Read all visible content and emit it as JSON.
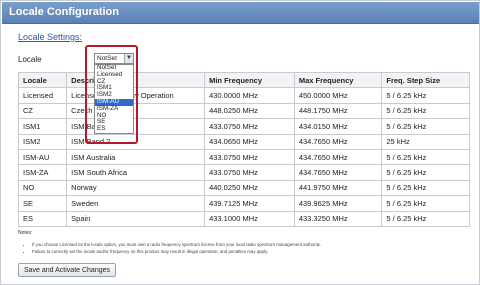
{
  "window": {
    "title": "Locale Configuration"
  },
  "section_link": "Locale Settings:",
  "locale": {
    "label": "Locale",
    "selected": "NotSet",
    "options": [
      "NotSet",
      "Licensed",
      "CZ",
      "ISM1",
      "ISM2",
      "ISM-AU",
      "ISM-ZA",
      "NO",
      "SE",
      "ES"
    ],
    "highlighted_option": "ISM-AU"
  },
  "table": {
    "headers": [
      "Locale",
      "Description",
      "Min Frequency",
      "Max Frequency",
      "Freq. Step Size"
    ],
    "rows": [
      [
        "Licensed",
        "Licensed Frequency Operation",
        "430.0000 MHz",
        "450.0000 MHz",
        "5 / 6.25 kHz"
      ],
      [
        "CZ",
        "Czech Republic",
        "448.0250 MHz",
        "448.1750 MHz",
        "5 / 6.25 kHz"
      ],
      [
        "ISM1",
        "ISM Band 1",
        "433.0750 MHz",
        "434.0150 MHz",
        "5 / 6.25 kHz"
      ],
      [
        "ISM2",
        "ISM Band 2",
        "434.0650 MHz",
        "434.7650 MHz",
        "25 kHz"
      ],
      [
        "ISM-AU",
        "ISM Australia",
        "433.0750 MHz",
        "434.7650 MHz",
        "5 / 6.25 kHz"
      ],
      [
        "ISM-ZA",
        "ISM South Africa",
        "433.0750 MHz",
        "434.7650 MHz",
        "5 / 6.25 kHz"
      ],
      [
        "NO",
        "Norway",
        "440.0250 MHz",
        "441.9750 MHz",
        "5 / 6.25 kHz"
      ],
      [
        "SE",
        "Sweden",
        "439.7125 MHz",
        "439.9625 MHz",
        "5 / 6.25 kHz"
      ],
      [
        "ES",
        "Spain",
        "433.1000 MHz",
        "433.3250 MHz",
        "5 / 6.25 kHz"
      ]
    ]
  },
  "notes": {
    "title": "Notes:",
    "items": [
      "If you choose Licensed as the locale option, you must own a radio frequency spectrum license from your local radio spectrum management authority.",
      "Failure to correctly set the locale and/or frequency on this product may result in illegal operation, and penalties may apply."
    ]
  },
  "buttons": {
    "save": "Save and Activate Changes"
  },
  "colors": {
    "titlebar": "#5b81b3",
    "selection": "#3169c6",
    "highlight_border": "#b01c2e"
  }
}
